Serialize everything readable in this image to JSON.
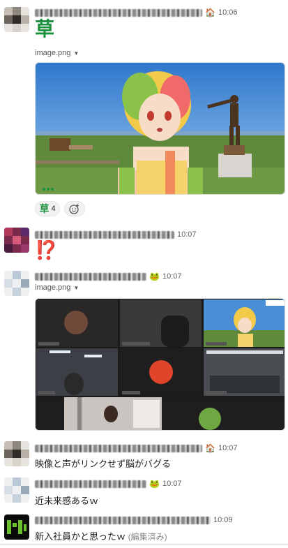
{
  "messages": [
    {
      "status_emoji": "🏠",
      "time": "10:06",
      "body": "草",
      "file_label": "image.png"
    },
    {
      "time": "10:07",
      "body": "⁉️"
    },
    {
      "status_emoji": "🐸",
      "time": "10:07",
      "file_label": "image.png"
    },
    {
      "status_emoji": "🏠",
      "time": "10:07",
      "body": "映像と声がリンクせず脳がバグる"
    },
    {
      "status_emoji": "🐸",
      "time": "10:07",
      "body": "近未来感あるｗ"
    },
    {
      "time": "10:09",
      "body": "新入社員かと思ったｗ",
      "edited": "(編集済み)"
    }
  ],
  "reactions": [
    {
      "emoji": "草",
      "count": "4"
    }
  ],
  "icons": {
    "add_reaction": "add-reaction-icon",
    "file_caret": "chevron-down-icon"
  },
  "colors": {
    "kusa_green": "#1a8f3c",
    "sky": "#4a8fd6",
    "grass": "#5f8a3c"
  }
}
